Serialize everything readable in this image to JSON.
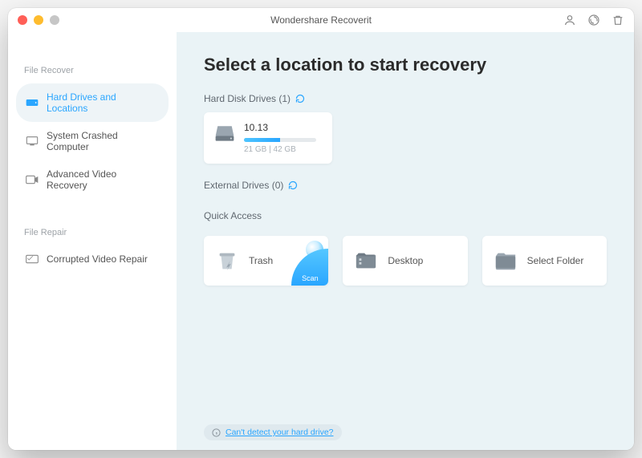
{
  "window": {
    "title": "Wondershare Recoverit"
  },
  "sidebar": {
    "section1": "File Recover",
    "section2": "File Repair",
    "items": [
      {
        "label": "Hard Drives and Locations"
      },
      {
        "label": "System Crashed Computer"
      },
      {
        "label": "Advanced Video Recovery"
      },
      {
        "label": "Corrupted Video Repair"
      }
    ]
  },
  "main": {
    "heading": "Select a location to start recovery",
    "hdd_header": "Hard Disk Drives (1)",
    "drive": {
      "name": "10.13",
      "sub": "21 GB | 42 GB"
    },
    "ext_header": "External Drives (0)",
    "qa_header": "Quick Access",
    "qa": {
      "trash": "Trash",
      "scan": "Scan",
      "desktop": "Desktop",
      "select": "Select Folder"
    },
    "help_link": "Can't detect your hard drive?"
  }
}
